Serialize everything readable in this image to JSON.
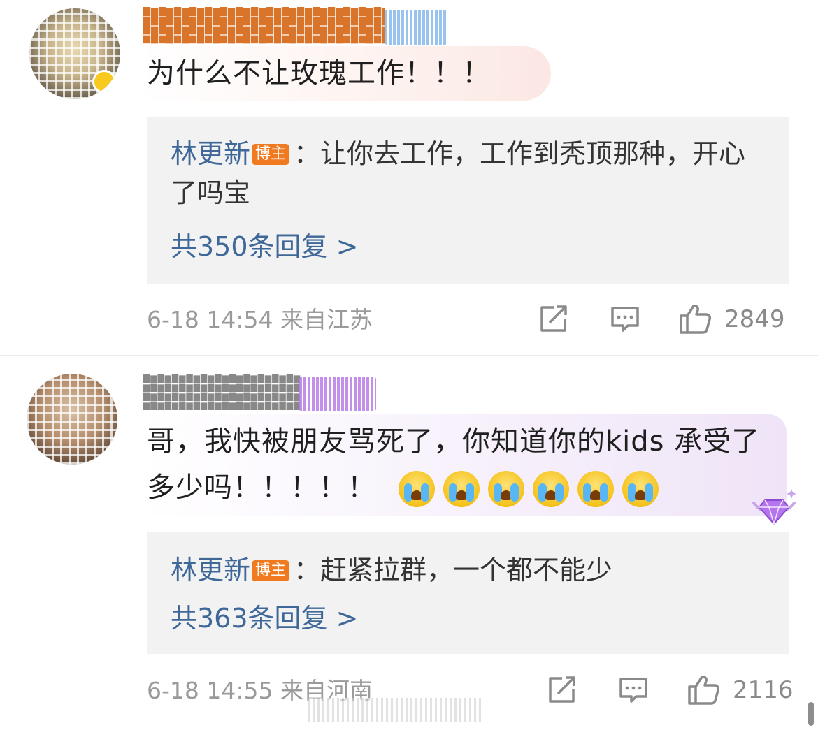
{
  "comments": [
    {
      "text": "为什么不让玫瑰工作！！！",
      "reply": {
        "author": "林更新",
        "author_tag": "博主",
        "text": "：让你去工作，工作到秃顶那种，开心了吗宝"
      },
      "more_replies": "共350条回复 >",
      "meta": "6-18 14:54  来自江苏",
      "likes": "2849"
    },
    {
      "text": "哥，我快被朋友骂死了，你知道你的kids 承受了多少吗！！！！！",
      "emoji": [
        "crying-emoji",
        "crying-emoji",
        "crying-emoji",
        "crying-emoji",
        "crying-emoji",
        "crying-emoji"
      ],
      "reply": {
        "author": "林更新",
        "author_tag": "博主",
        "text": "：赶紧拉群，一个都不能少"
      },
      "more_replies": "共363条回复 >",
      "meta": "6-18 14:55  来自河南",
      "likes": "2116"
    }
  ],
  "colors": {
    "link_blue": "#3f6899",
    "host_tag_orange": "#f07a20",
    "reply_bg": "#f2f2f2",
    "meta_gray": "#9a9a9a"
  }
}
